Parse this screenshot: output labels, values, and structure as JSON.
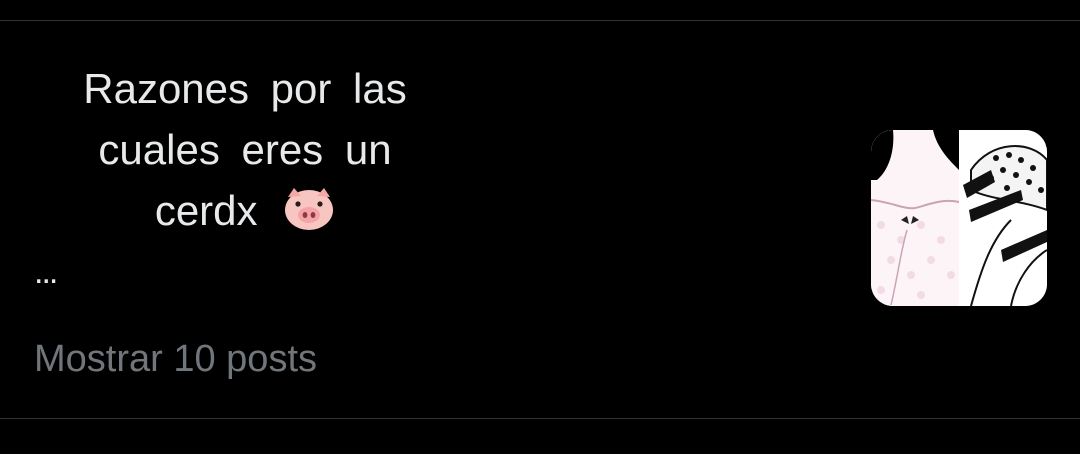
{
  "post": {
    "text": "Razones por las cuales eres un cerdx",
    "emoji": "pig-face-icon",
    "truncation": "...",
    "show_more_label": "Mostrar 10 posts"
  },
  "thumbnail": {
    "icon": "thumbnail-image"
  },
  "colors": {
    "background": "#000000",
    "text_primary": "#e7e9ea",
    "text_secondary": "#71767b",
    "divider": "#2f3336"
  }
}
